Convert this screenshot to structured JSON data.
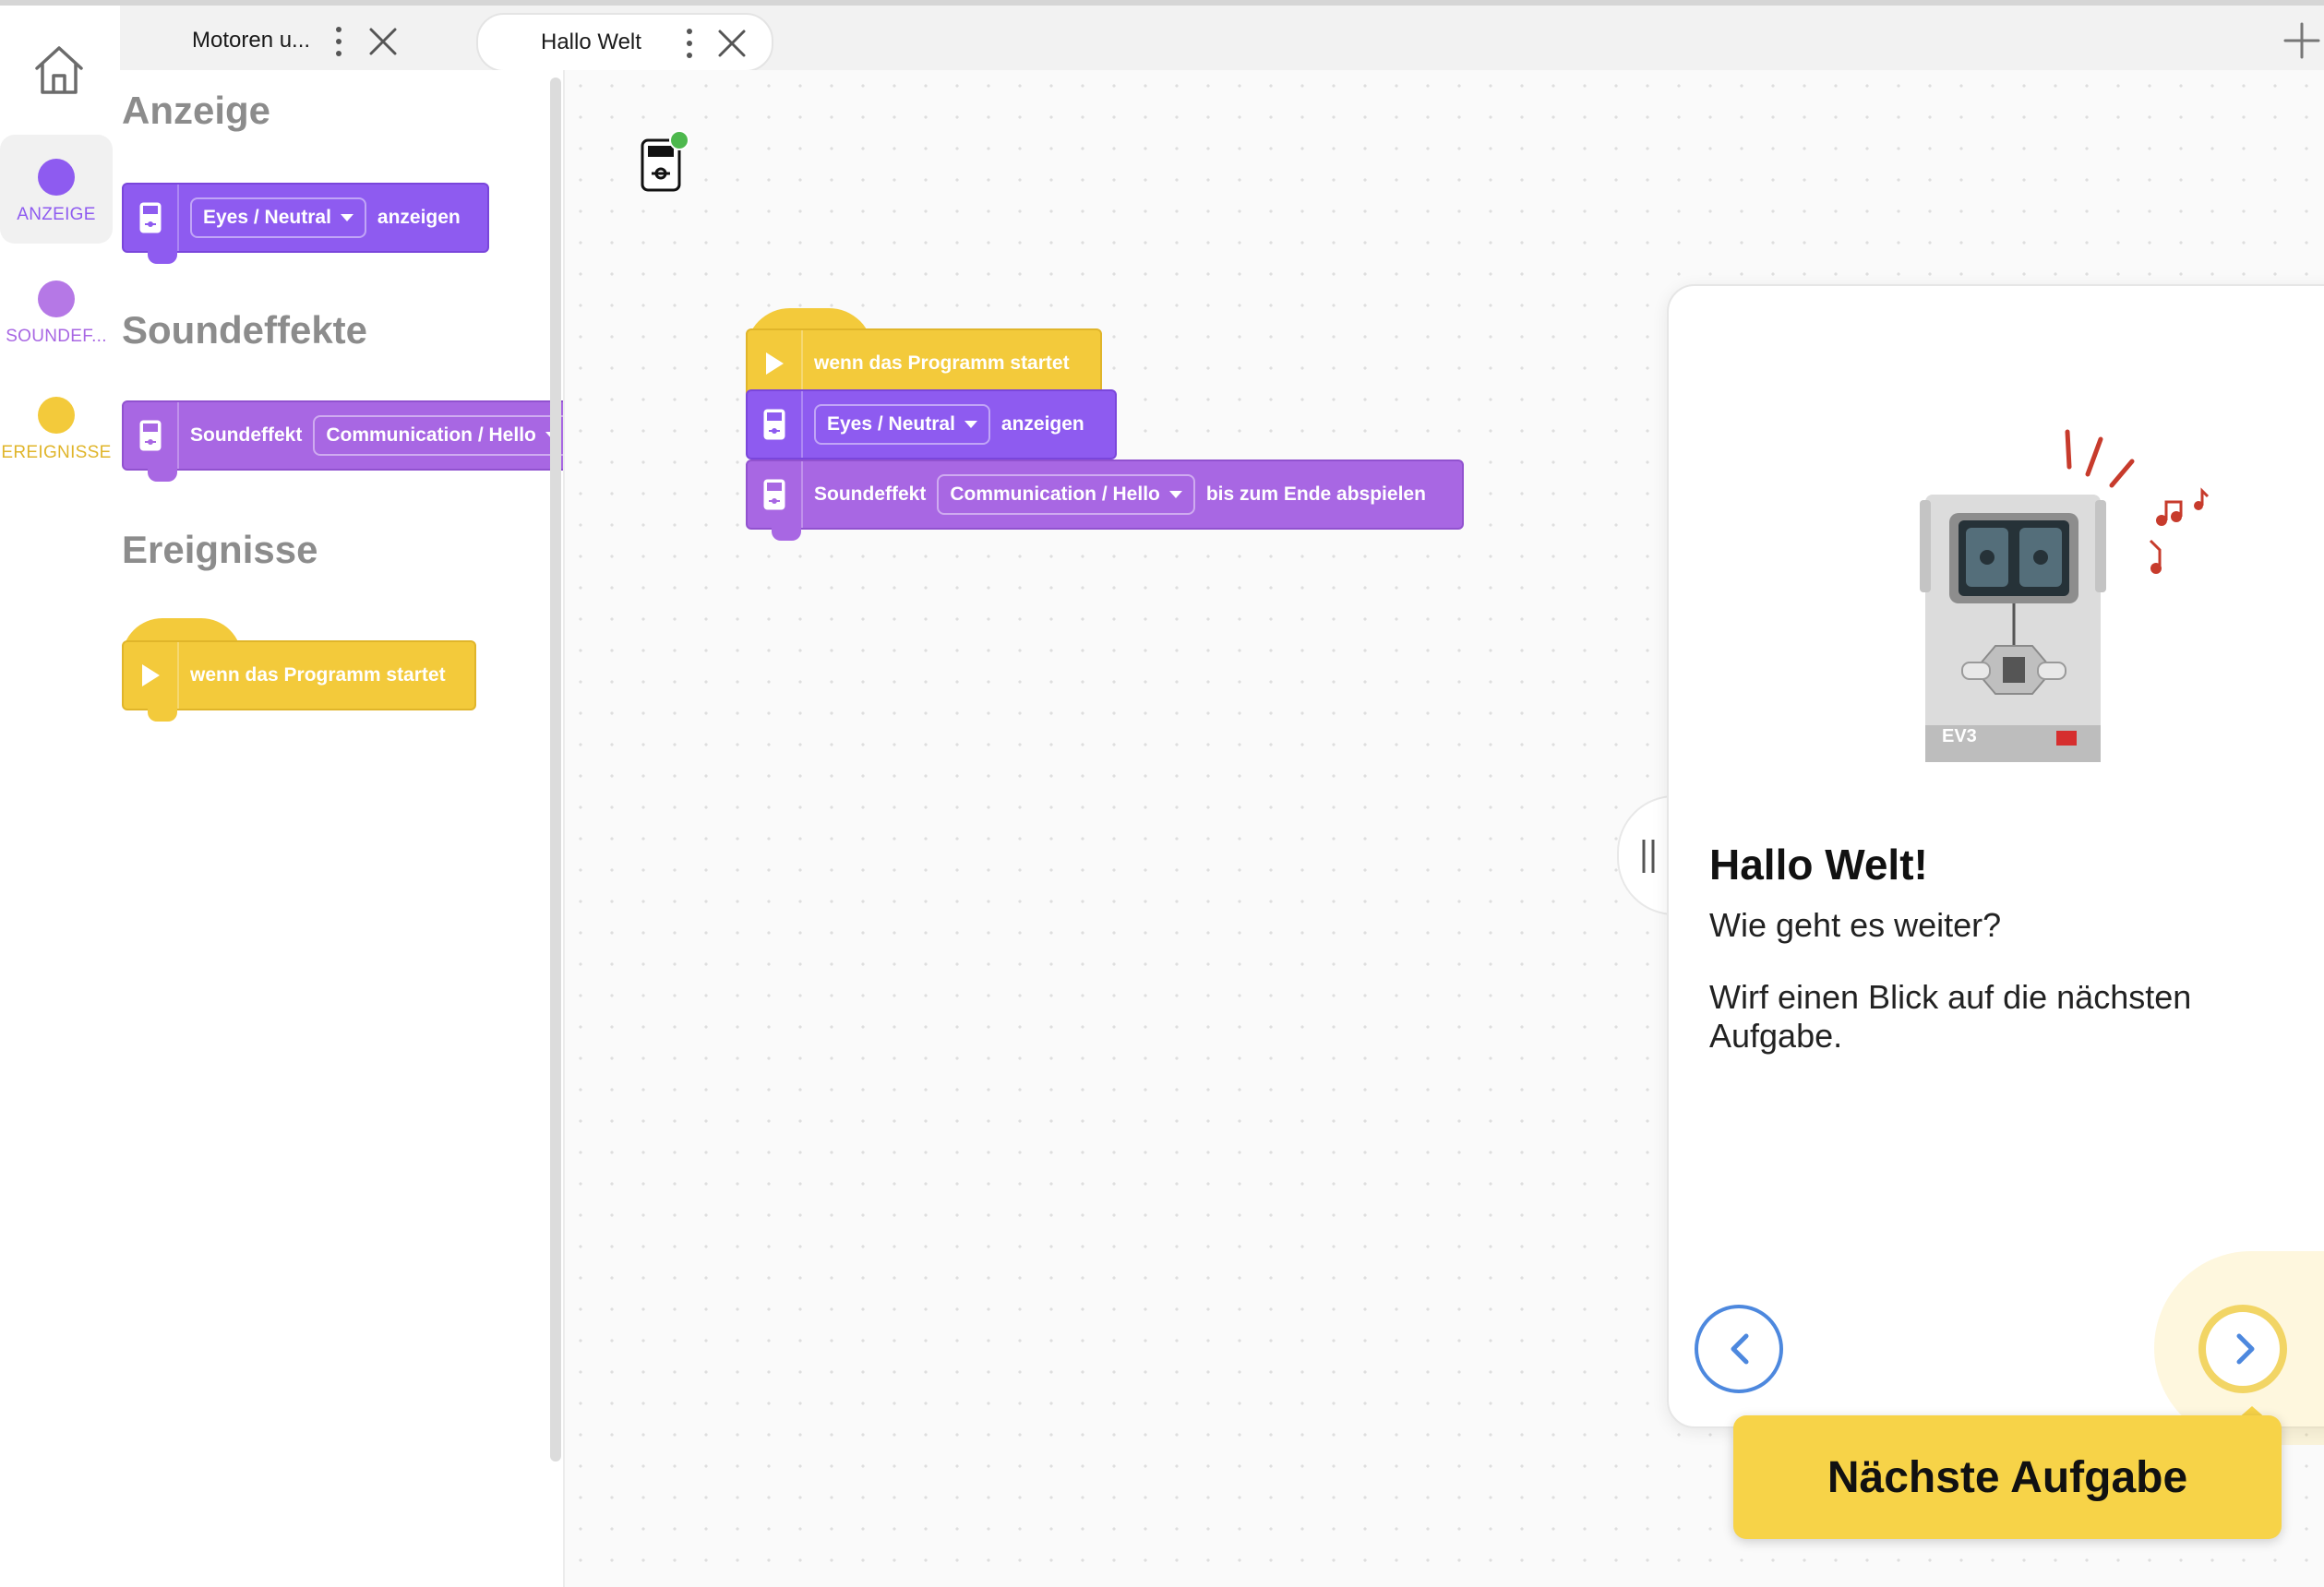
{
  "tabs": [
    {
      "title": "Motoren u..."
    },
    {
      "title": "Hallo Welt"
    }
  ],
  "categories": [
    {
      "label": "ANZEIGE",
      "color": "#8e5bf0"
    },
    {
      "label": "SOUNDEF...",
      "color": "#a867e3"
    },
    {
      "label": "EREIGNISSE",
      "color": "#f3ca3b"
    }
  ],
  "palette": {
    "anzeige": {
      "heading": "Anzeige",
      "block": {
        "dropdown": "Eyes / Neutral",
        "suffix": "anzeigen"
      }
    },
    "soundeffekte": {
      "heading": "Soundeffekte",
      "block": {
        "prefix": "Soundeffekt",
        "dropdown": "Communication / Hello"
      }
    },
    "ereignisse": {
      "heading": "Ereignisse",
      "block": {
        "text": "wenn das Programm startet"
      }
    }
  },
  "workspace": {
    "hat": {
      "text": "wenn das Programm startet"
    },
    "display": {
      "dropdown": "Eyes / Neutral",
      "suffix": "anzeigen"
    },
    "sound": {
      "prefix": "Soundeffekt",
      "dropdown": "Communication / Hello",
      "suffix": "bis zum Ende abspielen"
    }
  },
  "panel": {
    "title": "Hallo Welt!",
    "subtitle": "Wie geht es weiter?",
    "body": "Wirf einen Blick auf die nächsten Aufgabe.",
    "brick_label": "EV3",
    "next_cta": "Nächste Aufgabe"
  },
  "colors": {
    "display_block": "#8e5bf0",
    "sound_block": "#a867e3",
    "event_block": "#f3ca3b",
    "nav_blue": "#4d88de",
    "cta_yellow": "#f7d348"
  },
  "icons": [
    "home-icon",
    "kebab-icon",
    "close-icon",
    "plus-icon",
    "brick-icon",
    "play-icon",
    "chevron-left-icon",
    "chevron-right-icon",
    "music-note-icon"
  ]
}
